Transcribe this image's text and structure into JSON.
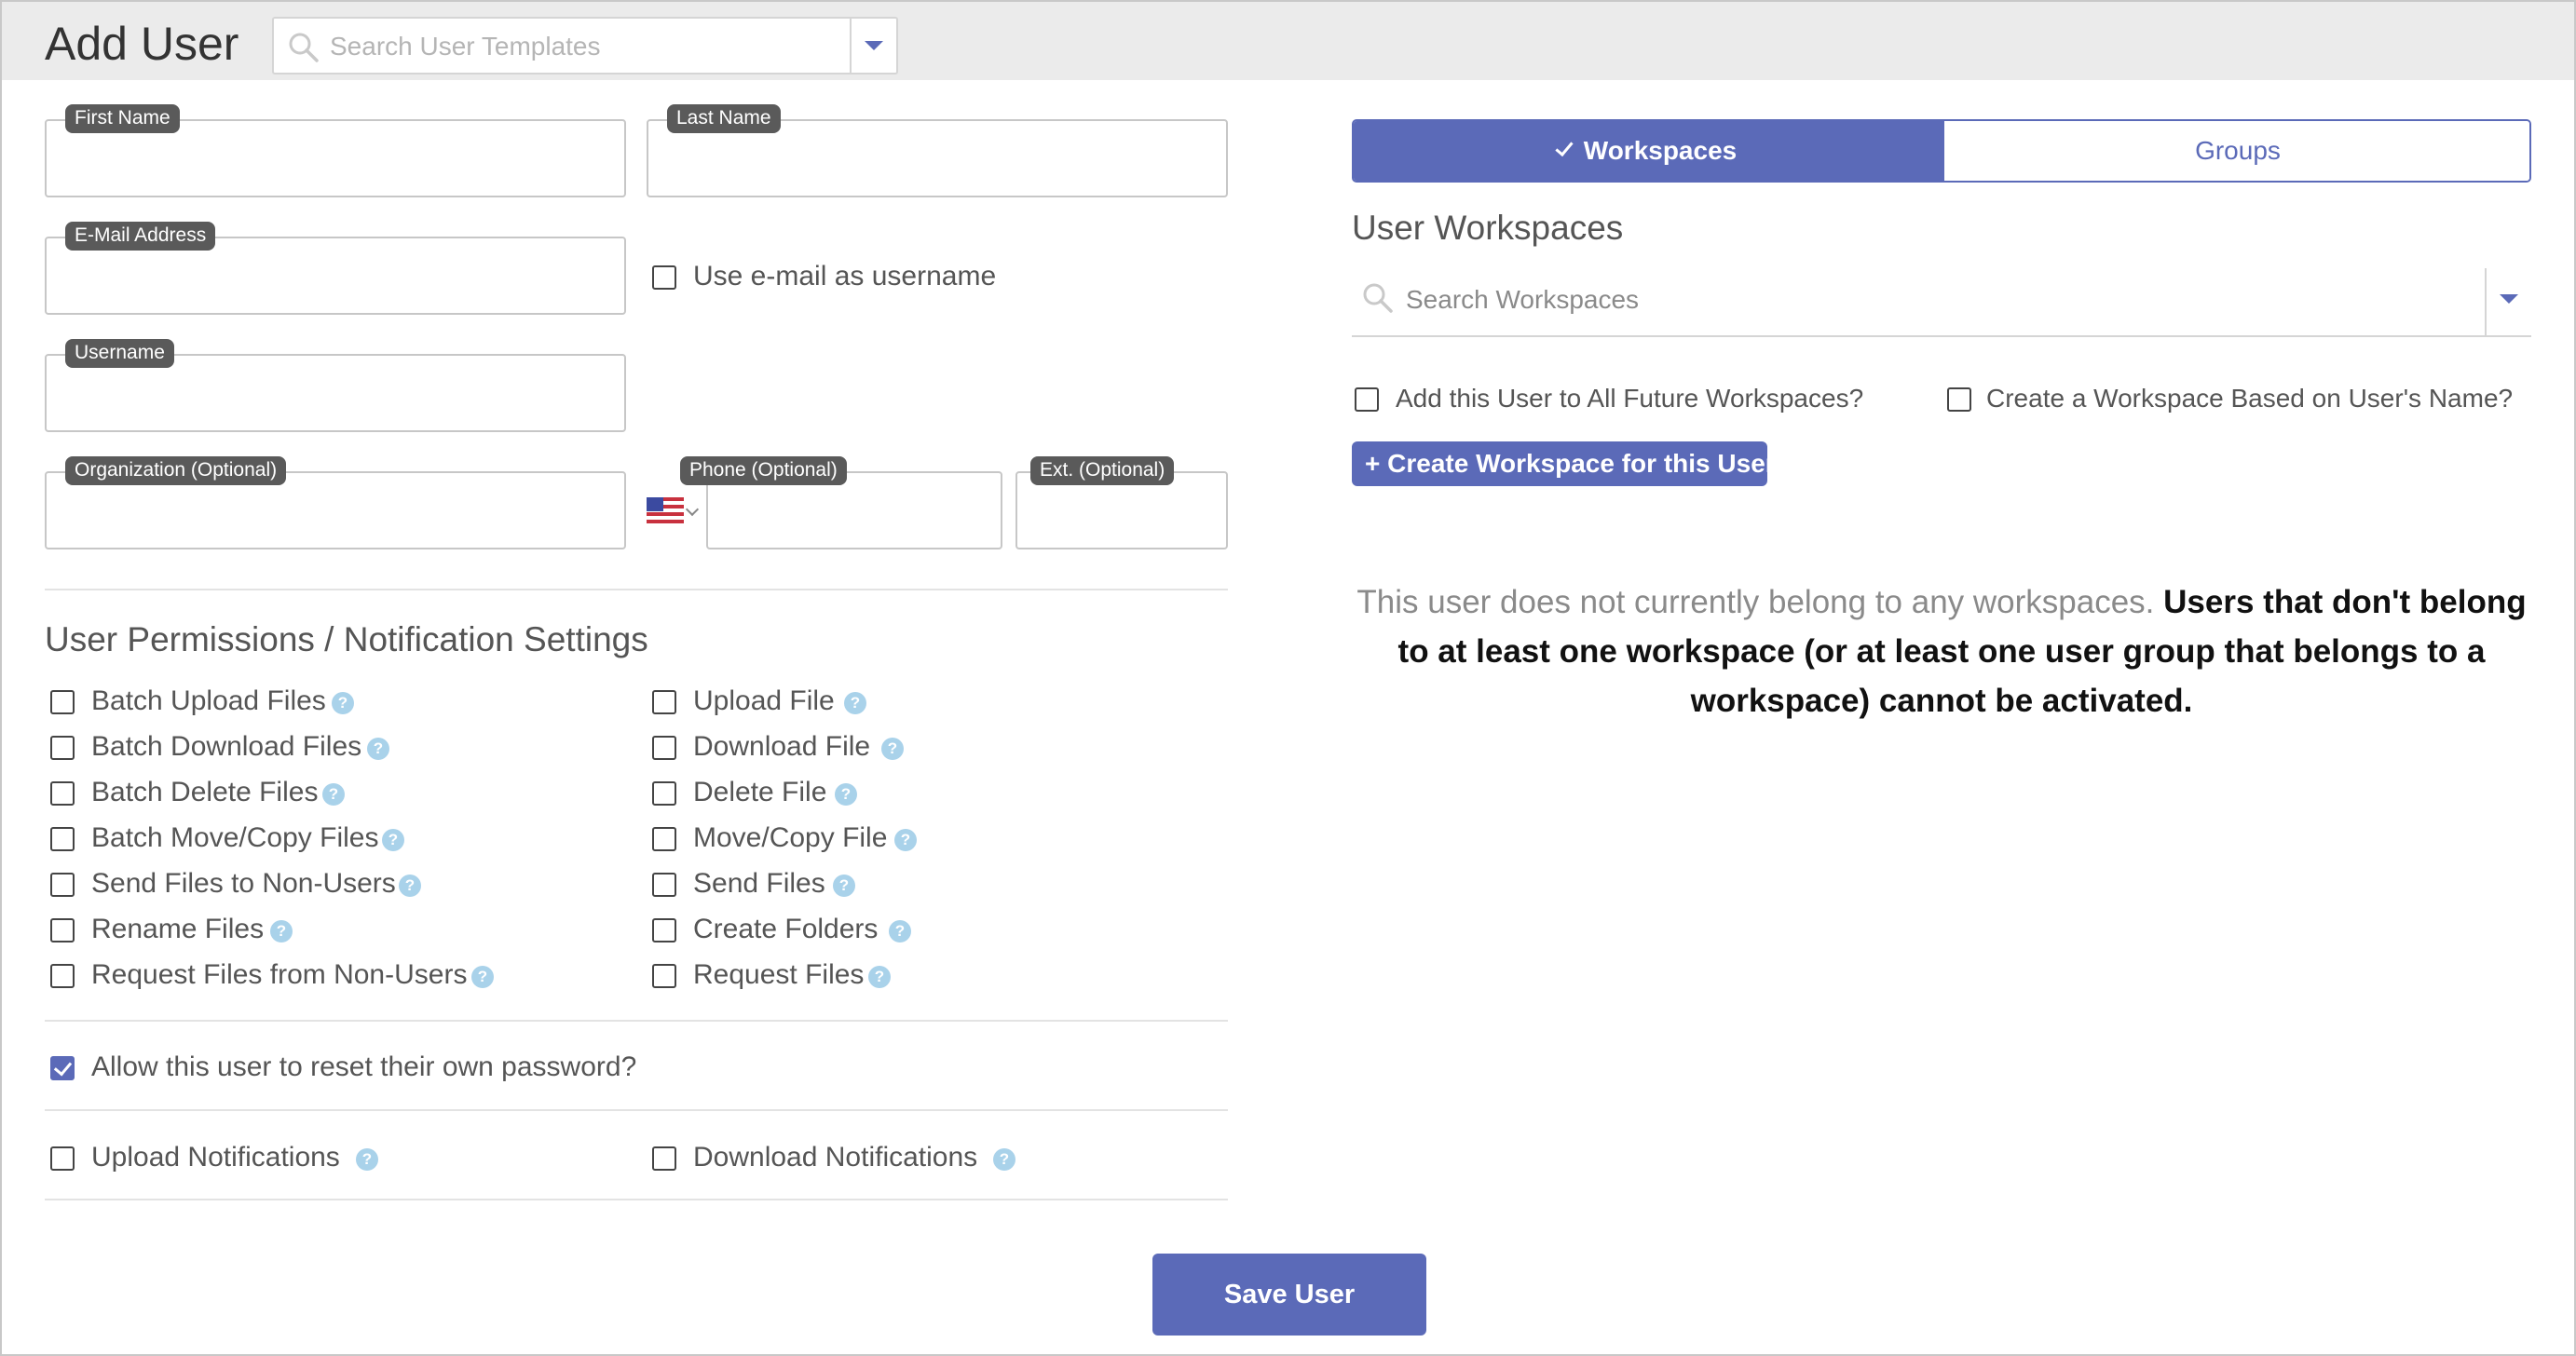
{
  "header": {
    "title": "Add User",
    "template_search_placeholder": "Search User Templates"
  },
  "form": {
    "first_name_label": "First Name",
    "last_name_label": "Last Name",
    "email_label": "E-Mail Address",
    "use_email_label": "Use e-mail as username",
    "username_label": "Username",
    "organization_label": "Organization (Optional)",
    "phone_label": "Phone (Optional)",
    "ext_label": "Ext. (Optional)",
    "phone_country_icon": "us-flag-icon"
  },
  "permissions": {
    "title": "User Permissions / Notification Settings",
    "left": [
      {
        "label": "Batch Upload Files",
        "checked": false
      },
      {
        "label": "Batch Download Files",
        "checked": false
      },
      {
        "label": "Batch Delete Files",
        "checked": false
      },
      {
        "label": "Batch Move/Copy Files",
        "checked": false
      },
      {
        "label": "Send Files to Non-Users",
        "checked": false
      },
      {
        "label": "Rename Files",
        "checked": false
      },
      {
        "label": "Request Files from Non-Users",
        "checked": false
      }
    ],
    "right": [
      {
        "label": "Upload File",
        "checked": false
      },
      {
        "label": "Download File",
        "checked": false
      },
      {
        "label": "Delete File",
        "checked": false
      },
      {
        "label": "Move/Copy File",
        "checked": false
      },
      {
        "label": "Send Files",
        "checked": false
      },
      {
        "label": "Create Folders",
        "checked": false
      },
      {
        "label": "Request Files",
        "checked": false
      }
    ],
    "reset_password": {
      "label": "Allow this user to reset their own password?",
      "checked": true
    },
    "upload_notifications": {
      "label": "Upload Notifications",
      "checked": false
    },
    "download_notifications": {
      "label": "Download Notifications",
      "checked": false
    },
    "help_glyph": "?"
  },
  "workspaces_panel": {
    "tabs": {
      "workspaces": "Workspaces",
      "groups": "Groups",
      "active": "workspaces"
    },
    "section_title": "User Workspaces",
    "search_placeholder": "Search Workspaces",
    "add_future_label": "Add this User to All Future Workspaces?",
    "create_named_label": "Create a Workspace Based on User's Name?",
    "create_button": "+ Create Workspace for this User",
    "notice_normal": "This user does not currently belong to any workspaces.",
    "notice_bold": "Users that don't belong to at least one workspace (or at least one user group that belongs to a workspace) cannot be activated."
  },
  "footer": {
    "save_button": "Save User"
  },
  "colors": {
    "accent": "#5b6ab8",
    "help_icon": "#a9d2ea",
    "label_chip": "#5a5a5a",
    "header_bg": "#ebebeb"
  }
}
